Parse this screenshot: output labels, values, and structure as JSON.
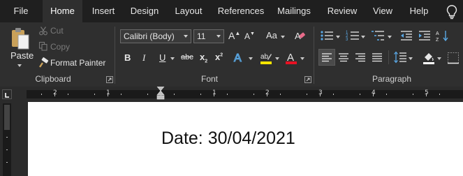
{
  "tabs": [
    {
      "label": "File",
      "active": false
    },
    {
      "label": "Home",
      "active": true
    },
    {
      "label": "Insert",
      "active": false
    },
    {
      "label": "Design",
      "active": false
    },
    {
      "label": "Layout",
      "active": false
    },
    {
      "label": "References",
      "active": false
    },
    {
      "label": "Mailings",
      "active": false
    },
    {
      "label": "Review",
      "active": false
    },
    {
      "label": "View",
      "active": false
    },
    {
      "label": "Help",
      "active": false
    }
  ],
  "clipboard": {
    "paste_label": "Paste",
    "cut_label": "Cut",
    "copy_label": "Copy",
    "format_painter_label": "Format Painter",
    "group_label": "Clipboard"
  },
  "font": {
    "font_name": "Calibri (Body)",
    "font_size": "11",
    "grow_label": "A",
    "shrink_label": "A",
    "case_label": "Aa",
    "bold_label": "B",
    "italic_label": "I",
    "underline_label": "U",
    "strike_label": "abc",
    "subscript_label": "x",
    "superscript_label": "x",
    "group_label": "Font",
    "highlight_color": "#f5e400",
    "font_color": "#e81123"
  },
  "paragraph": {
    "group_label": "Paragraph"
  },
  "ruler": {
    "numbers": [
      "2",
      "1",
      "1",
      "2",
      "3",
      "4",
      "5"
    ]
  },
  "document": {
    "text": "Date: 30/04/2021"
  },
  "colors": {
    "accent": "#2b579a",
    "ribbon_bg": "#2f2f2f",
    "tabbar_bg": "#1f1f1f",
    "page_bg": "#ffffff"
  }
}
